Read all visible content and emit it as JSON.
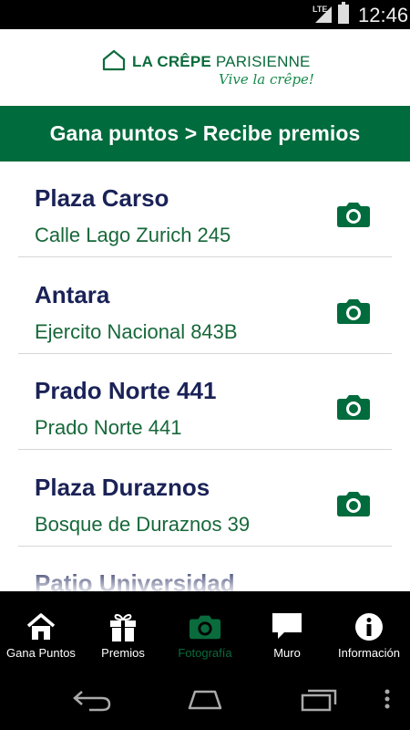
{
  "status_bar": {
    "network": "LTE",
    "time": "12:46"
  },
  "header": {
    "brand_bold": "LA CRÊPE",
    "brand_light": "PARISIENNE",
    "tagline": "Vive la crêpe!"
  },
  "banner": {
    "title": "Gana puntos > Recibe premios"
  },
  "locations": [
    {
      "name": "Plaza Carso",
      "address": "Calle Lago Zurich 245",
      "icon": "camera-icon"
    },
    {
      "name": "Antara",
      "address": "Ejercito Nacional 843B",
      "icon": "camera-icon"
    },
    {
      "name": "Prado Norte 441",
      "address": "Prado Norte 441",
      "icon": "camera-icon"
    },
    {
      "name": "Plaza Duraznos",
      "address": "Bosque de Duraznos 39",
      "icon": "camera-icon"
    },
    {
      "name": "Patio Universidad",
      "address": "",
      "icon": "camera-icon"
    }
  ],
  "tabs": [
    {
      "label": "Gana Puntos",
      "icon": "home-icon",
      "active": false
    },
    {
      "label": "Premios",
      "icon": "gift-icon",
      "active": false
    },
    {
      "label": "Fotografía",
      "icon": "camera-icon",
      "active": true
    },
    {
      "label": "Muro",
      "icon": "speech-bubble-icon",
      "active": false
    },
    {
      "label": "Información",
      "icon": "info-icon",
      "active": false
    }
  ],
  "colors": {
    "brand_green": "#006b3c",
    "title_navy": "#1a2257",
    "address_green": "#17683a",
    "active_tab": "#0a6b3c"
  }
}
